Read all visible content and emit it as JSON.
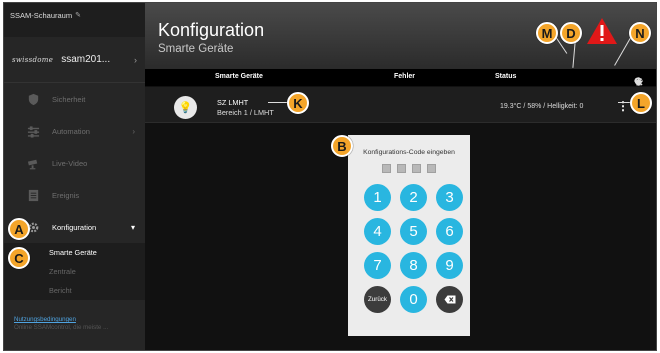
{
  "sidebar": {
    "top_title": "SSAM-Schauraum",
    "org_logo": "swissdome",
    "org_name": "ssam201...",
    "items": [
      {
        "label": "Sicherheit",
        "icon": "shield-icon"
      },
      {
        "label": "Automation",
        "icon": "sliders-icon"
      },
      {
        "label": "Live-Video",
        "icon": "camera-icon"
      },
      {
        "label": "Ereignis",
        "icon": "log-icon"
      },
      {
        "label": "Konfiguration",
        "icon": "gear-icon"
      }
    ],
    "subitems": [
      {
        "label": "Smarte Geräte"
      },
      {
        "label": "Zentrale"
      },
      {
        "label": "Bericht"
      }
    ],
    "footer_link": "Nutzungsbedingungen",
    "footer_text": "Online SSAMcontrol, die meiste ..."
  },
  "header": {
    "title": "Konfiguration",
    "subtitle": "Smarte Geräte"
  },
  "table": {
    "columns": [
      "Smarte Geräte",
      "Fehler",
      "Status"
    ],
    "tools": [
      "search-icon",
      "add-icon",
      "wifi-icon",
      "refresh-icon",
      "delete-icon"
    ],
    "rows": [
      {
        "name": "SZ LMHT",
        "area": "Bereich 1 / LMHT",
        "status": "19.3°C / 58% / Helligkeit: 0"
      }
    ]
  },
  "keypad": {
    "title": "Konfigurations-Code eingeben",
    "keys": [
      "1",
      "2",
      "3",
      "4",
      "5",
      "6",
      "7",
      "8",
      "9",
      "Zurück",
      "0",
      "backspace-icon"
    ],
    "back_label": "Zurück"
  },
  "markers": {
    "A": "A",
    "B": "B",
    "C": "C",
    "D": "D",
    "K": "K",
    "L": "L",
    "M": "M",
    "N": "N"
  },
  "colors": {
    "accent": "#29b6e0",
    "marker": "#f4a52a",
    "warning": "#e01818"
  }
}
